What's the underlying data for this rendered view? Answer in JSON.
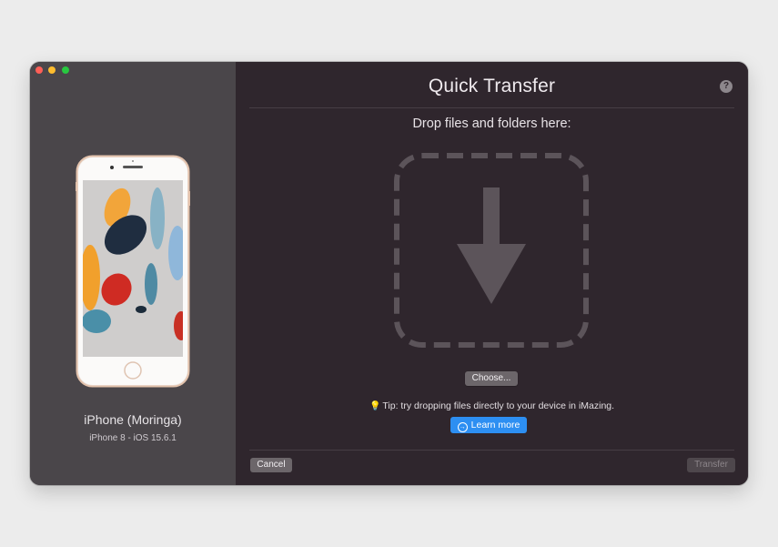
{
  "window": {
    "title": "Quick Transfer",
    "help_label": "?"
  },
  "device": {
    "name": "iPhone (Moringa)",
    "model": "iPhone 8 - iOS 15.6.1",
    "icon": "iphone-8-gold-image"
  },
  "drop": {
    "prompt": "Drop files and folders here:",
    "icon": "download-arrow-icon"
  },
  "buttons": {
    "choose": "Choose...",
    "learn_more": "Learn more",
    "cancel": "Cancel",
    "transfer": "Transfer"
  },
  "tip": {
    "text": "Tip: try dropping files directly to your device in iMazing.",
    "icon": "lightbulb-icon"
  },
  "colors": {
    "accent": "#2d8ff2",
    "sidebar_bg": "#4a464a",
    "main_bg": "#2f262d"
  }
}
